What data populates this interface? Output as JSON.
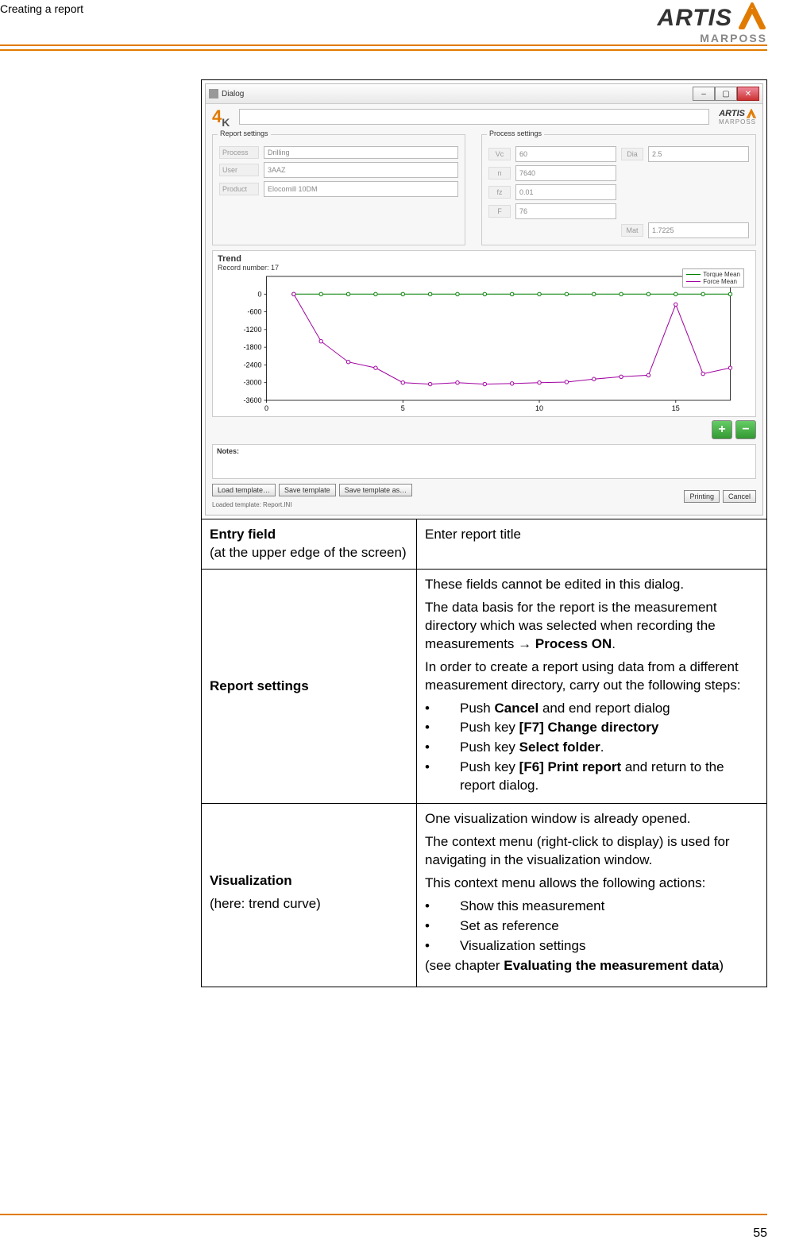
{
  "header": {
    "running_title": "Creating a report"
  },
  "logo": {
    "brand1": "ARTIS",
    "brand2": "MARPOSS"
  },
  "dialog": {
    "title": "Dialog",
    "brand_small_1": "ARTIS",
    "brand_small_2": "MARPOSS",
    "report_settings_legend": "Report settings",
    "process_settings_legend": "Process settings",
    "labels": {
      "process": "Process",
      "user": "User",
      "product": "Product",
      "vc": "Vc",
      "dia": "Dia",
      "n": "n",
      "fz": "fz",
      "f": "F",
      "mat": "Mat"
    },
    "values": {
      "process": "Drilling",
      "user": "3AAZ",
      "product": "Elocomill 10DM",
      "vc": "60",
      "dia": "2.5",
      "n": "7640",
      "fz": "0.01",
      "f": "76",
      "mat": "1.7225"
    },
    "chart": {
      "title": "Trend",
      "subtitle": "Record number: 17",
      "legend1": "Torque Mean",
      "legend2": "Force Mean"
    },
    "notes_label": "Notes:",
    "buttons": {
      "load": "Load template…",
      "save": "Save template",
      "saveas": "Save template as…",
      "printing": "Printing",
      "cancel": "Cancel"
    },
    "status": "Loaded template: Report.INI"
  },
  "table": {
    "row1": {
      "left_bold": "Entry field",
      "left_sub": "(at the upper edge of the screen)",
      "right": "Enter report title"
    },
    "row2": {
      "left": "Report settings",
      "p1": "These fields cannot be edited in this dialog.",
      "p2a": "The data basis for the report is the measurement directory which was selected when recording the measurements ",
      "p2arrow": "→",
      "p2b": " Process ON",
      "p2c": ".",
      "p3": "In order to create a report using data from a different measurement directory, carry out the following steps:",
      "b1a": "Push ",
      "b1b": "Cancel",
      "b1c": " and end report dialog",
      "b2a": "Push key ",
      "b2b": "[F7] Change directory",
      "b3a": "Push key ",
      "b3b": "Select folder",
      "b3c": ".",
      "b4a": "Push key ",
      "b4b": "[F6] Print report",
      "b4c": " and return to the report dialog."
    },
    "row3": {
      "left_bold": "Visualization",
      "left_sub": "(here: trend curve)",
      "p1": "One visualization window is already opened.",
      "p2": "The context menu (right-click to display) is used for navigating in the visualization window.",
      "p3": "This context menu allows the following actions:",
      "b1": "Show this measurement",
      "b2": "Set as reference",
      "b3": "Visualization settings",
      "p4a": "(see chapter ",
      "p4b": "Evaluating the measurement data",
      "p4c": ")"
    }
  },
  "page_number": "55",
  "chart_data": {
    "type": "line",
    "title": "Trend",
    "subtitle": "Record number: 17",
    "xlabel": "",
    "ylabel": "",
    "xlim": [
      0,
      17
    ],
    "ylim": [
      -3600,
      600
    ],
    "x": [
      1,
      2,
      3,
      4,
      5,
      6,
      7,
      8,
      9,
      10,
      11,
      12,
      13,
      14,
      15,
      16,
      17
    ],
    "series": [
      {
        "name": "Torque Mean",
        "color": "#008000",
        "values": [
          0,
          0,
          0,
          0,
          0,
          0,
          0,
          0,
          0,
          0,
          0,
          0,
          0,
          0,
          0,
          0,
          0
        ]
      },
      {
        "name": "Force Mean",
        "color": "#a000a0",
        "values": [
          0,
          -1600,
          -2300,
          -2500,
          -3000,
          -3050,
          -3000,
          -3050,
          -3030,
          -3000,
          -2980,
          -2880,
          -2800,
          -2750,
          -350,
          -2700,
          -2500
        ]
      }
    ],
    "yticks": [
      0,
      -600,
      -1200,
      -1800,
      -2400,
      -3000,
      -3600
    ],
    "xticks": [
      0,
      5,
      10,
      15
    ]
  }
}
